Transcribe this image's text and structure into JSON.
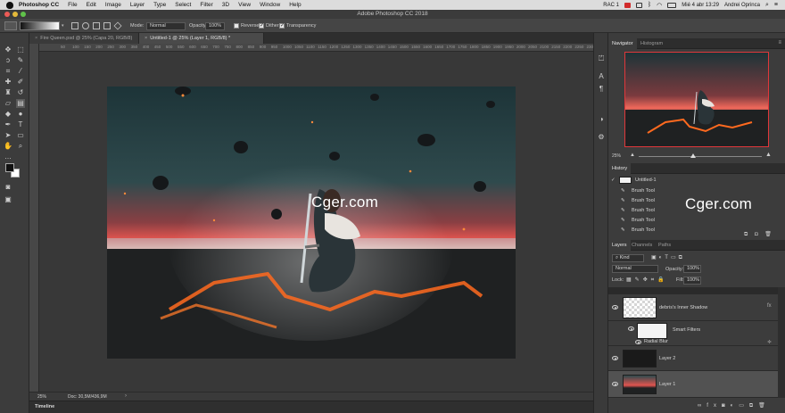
{
  "menubar": {
    "app_name": "Photoshop CC",
    "items": [
      "File",
      "Edit",
      "Image",
      "Layer",
      "Type",
      "Select",
      "Filter",
      "3D",
      "View",
      "Window",
      "Help"
    ],
    "battery_label": "RAC 1",
    "clock": "Mié 4 abr  13:29",
    "user": "Andrei Oprinca"
  },
  "window": {
    "title": "Adobe Photoshop CC 2018"
  },
  "options": {
    "mode_label": "Mode:",
    "mode_value": "Normal",
    "opacity_label": "Opacity:",
    "opacity_value": "100%",
    "reverse_label": "Reverse",
    "dither_label": "Dither",
    "transparency_label": "Transparency"
  },
  "doc_tabs": [
    {
      "label": "Fire Queen.psd @ 25% (Capa 20, RGB/8)"
    },
    {
      "label": "Untitled-1 @ 25% (Layer 1, RGB/8) *"
    }
  ],
  "ruler_ticks": [
    "50",
    "100",
    "150",
    "200",
    "250",
    "300",
    "350",
    "400",
    "450",
    "500",
    "550",
    "600",
    "650",
    "700",
    "750",
    "800",
    "850",
    "900",
    "950",
    "1000",
    "1050",
    "1100",
    "1150",
    "1200",
    "1250",
    "1300",
    "1350",
    "1400",
    "1450",
    "1500",
    "1550",
    "1600",
    "1650",
    "1700",
    "1750",
    "1800",
    "1850",
    "1900",
    "1950",
    "2000",
    "2050",
    "2100",
    "2150",
    "2200",
    "2250",
    "2300"
  ],
  "status": {
    "zoom": "25%",
    "doc": "Doc: 30,5M/436,9M"
  },
  "timeline_label": "Timeline",
  "navigator": {
    "tabs": [
      "Navigator",
      "Histogram"
    ],
    "zoom": "25%"
  },
  "history": {
    "title": "History",
    "snapshot": "Untitled-1",
    "items": [
      "Brush Tool",
      "Brush Tool",
      "Brush Tool",
      "Brush Tool",
      "Brush Tool"
    ]
  },
  "layers": {
    "tabs": [
      "Layers",
      "Channels",
      "Paths"
    ],
    "filter_kind": "Kind",
    "blend_mode": "Normal",
    "opacity_label": "Opacity:",
    "opacity_value": "100%",
    "lock_label": "Lock:",
    "fill_label": "Fill:",
    "fill_value": "100%",
    "items": [
      {
        "name": "debris's Inner Shadow"
      },
      {
        "name": "Smart Filters"
      },
      {
        "name": "Radial Blur"
      },
      {
        "name": "Layer 2"
      },
      {
        "name": "Layer 1"
      }
    ]
  },
  "watermark": "Cger.com",
  "colors": {
    "accent_red": "#e1373a",
    "panel_bg": "#3c3c3c",
    "canvas_bg": "#383838"
  }
}
